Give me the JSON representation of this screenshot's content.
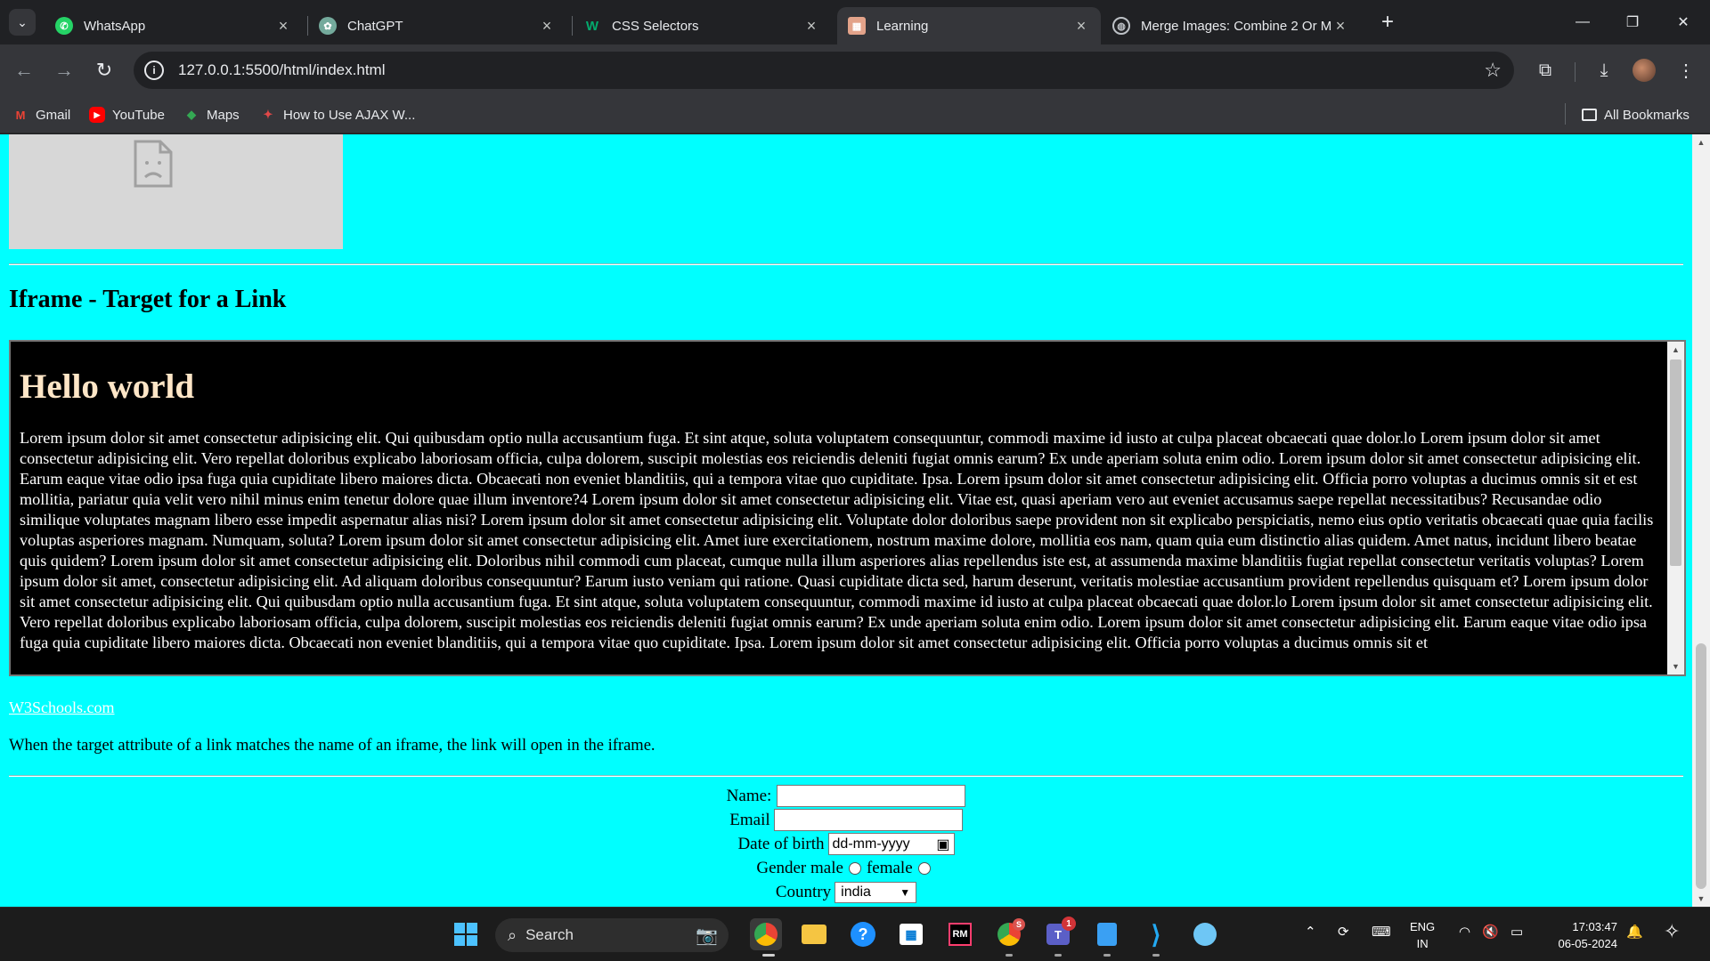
{
  "tabs": [
    {
      "title": "WhatsApp",
      "icon": "whatsapp-icon",
      "color": "#25d366"
    },
    {
      "title": "ChatGPT",
      "icon": "chatgpt-icon",
      "color": "#74aa9c"
    },
    {
      "title": "CSS Selectors",
      "icon": "w3schools-icon",
      "color": "#04aa6d"
    },
    {
      "title": "Learning",
      "icon": "learning-page-icon",
      "color": "#e3a38a"
    },
    {
      "title": "Merge Images: Combine 2 Or M",
      "icon": "globe-icon",
      "color": "#bdc1c6"
    }
  ],
  "address_bar": {
    "url": "127.0.0.1:5500/html/index.html"
  },
  "bookmarks": [
    {
      "label": "Gmail",
      "icon": "gmail-icon"
    },
    {
      "label": "YouTube",
      "icon": "youtube-icon"
    },
    {
      "label": "Maps",
      "icon": "maps-icon"
    },
    {
      "label": "How to Use AJAX W...",
      "icon": "bookmark-site-icon"
    }
  ],
  "all_bookmarks_label": "All Bookmarks",
  "page": {
    "heading": "Iframe - Target for a Link",
    "iframe": {
      "title": "Hello world",
      "text": "Lorem ipsum dolor sit amet consectetur adipisicing elit. Qui quibusdam optio nulla accusantium fuga. Et sint atque, soluta voluptatem consequuntur, commodi maxime id iusto at culpa placeat obcaecati quae dolor.lo Lorem ipsum dolor sit amet consectetur adipisicing elit. Vero repellat doloribus explicabo laboriosam officia, culpa dolorem, suscipit molestias eos reiciendis deleniti fugiat omnis earum? Ex unde aperiam soluta enim odio. Lorem ipsum dolor sit amet consectetur adipisicing elit. Earum eaque vitae odio ipsa fuga quia cupiditate libero maiores dicta. Obcaecati non eveniet blanditiis, qui a tempora vitae quo cupiditate. Ipsa. Lorem ipsum dolor sit amet consectetur adipisicing elit. Officia porro voluptas a ducimus omnis sit et est mollitia, pariatur quia velit vero nihil minus enim tenetur dolore quae illum inventore?4 Lorem ipsum dolor sit amet consectetur adipisicing elit. Vitae est, quasi aperiam vero aut eveniet accusamus saepe repellat necessitatibus? Recusandae odio similique voluptates magnam libero esse impedit aspernatur alias nisi? Lorem ipsum dolor sit amet consectetur adipisicing elit. Voluptate dolor doloribus saepe provident non sit explicabo perspiciatis, nemo eius optio veritatis obcaecati quae quia facilis voluptas asperiores magnam. Numquam, soluta? Lorem ipsum dolor sit amet consectetur adipisicing elit. Amet iure exercitationem, nostrum maxime dolore, mollitia eos nam, quam quia eum distinctio alias quidem. Amet natus, incidunt libero beatae quis quidem? Lorem ipsum dolor sit amet consectetur adipisicing elit. Doloribus nihil commodi cum placeat, cumque nulla illum asperiores alias repellendus iste est, at assumenda maxime blanditiis fugiat repellat consectetur veritatis voluptas? Lorem ipsum dolor sit amet, consectetur adipisicing elit. Ad aliquam doloribus consequuntur? Earum iusto veniam qui ratione. Quasi cupiditate dicta sed, harum deserunt, veritatis molestiae accusantium provident repellendus quisquam et? Lorem ipsum dolor sit amet consectetur adipisicing elit. Qui quibusdam optio nulla accusantium fuga. Et sint atque, soluta voluptatem consequuntur, commodi maxime id iusto at culpa placeat obcaecati quae dolor.lo Lorem ipsum dolor sit amet consectetur adipisicing elit. Vero repellat doloribus explicabo laboriosam officia, culpa dolorem, suscipit molestias eos reiciendis deleniti fugiat omnis earum? Ex unde aperiam soluta enim odio. Lorem ipsum dolor sit amet consectetur adipisicing elit. Earum eaque vitae odio ipsa fuga quia cupiditate libero maiores dicta. Obcaecati non eveniet blanditiis, qui a tempora vitae quo cupiditate. Ipsa. Lorem ipsum dolor sit amet consectetur adipisicing elit. Officia porro voluptas a ducimus omnis sit et"
    },
    "link_text": "W3Schools.com",
    "paragraph": "When the target attribute of a link matches the name of an iframe, the link will open in the iframe.",
    "form": {
      "name_label": "Name:",
      "email_label": "Email",
      "dob_label": "Date of birth",
      "dob_placeholder": "dd-mm-yyyy",
      "gender_label": "Gender",
      "male_label": "male",
      "female_label": "female",
      "country_label": "Country",
      "country_value": "india"
    },
    "colors": {
      "background": "#00ffff",
      "iframe_background": "#000000"
    }
  },
  "taskbar": {
    "search_label": "Search",
    "language_line1": "ENG",
    "language_line2": "IN",
    "time": "17:03:47",
    "date": "06-05-2024",
    "teams_badge": "1",
    "chrome_badge": "S"
  }
}
